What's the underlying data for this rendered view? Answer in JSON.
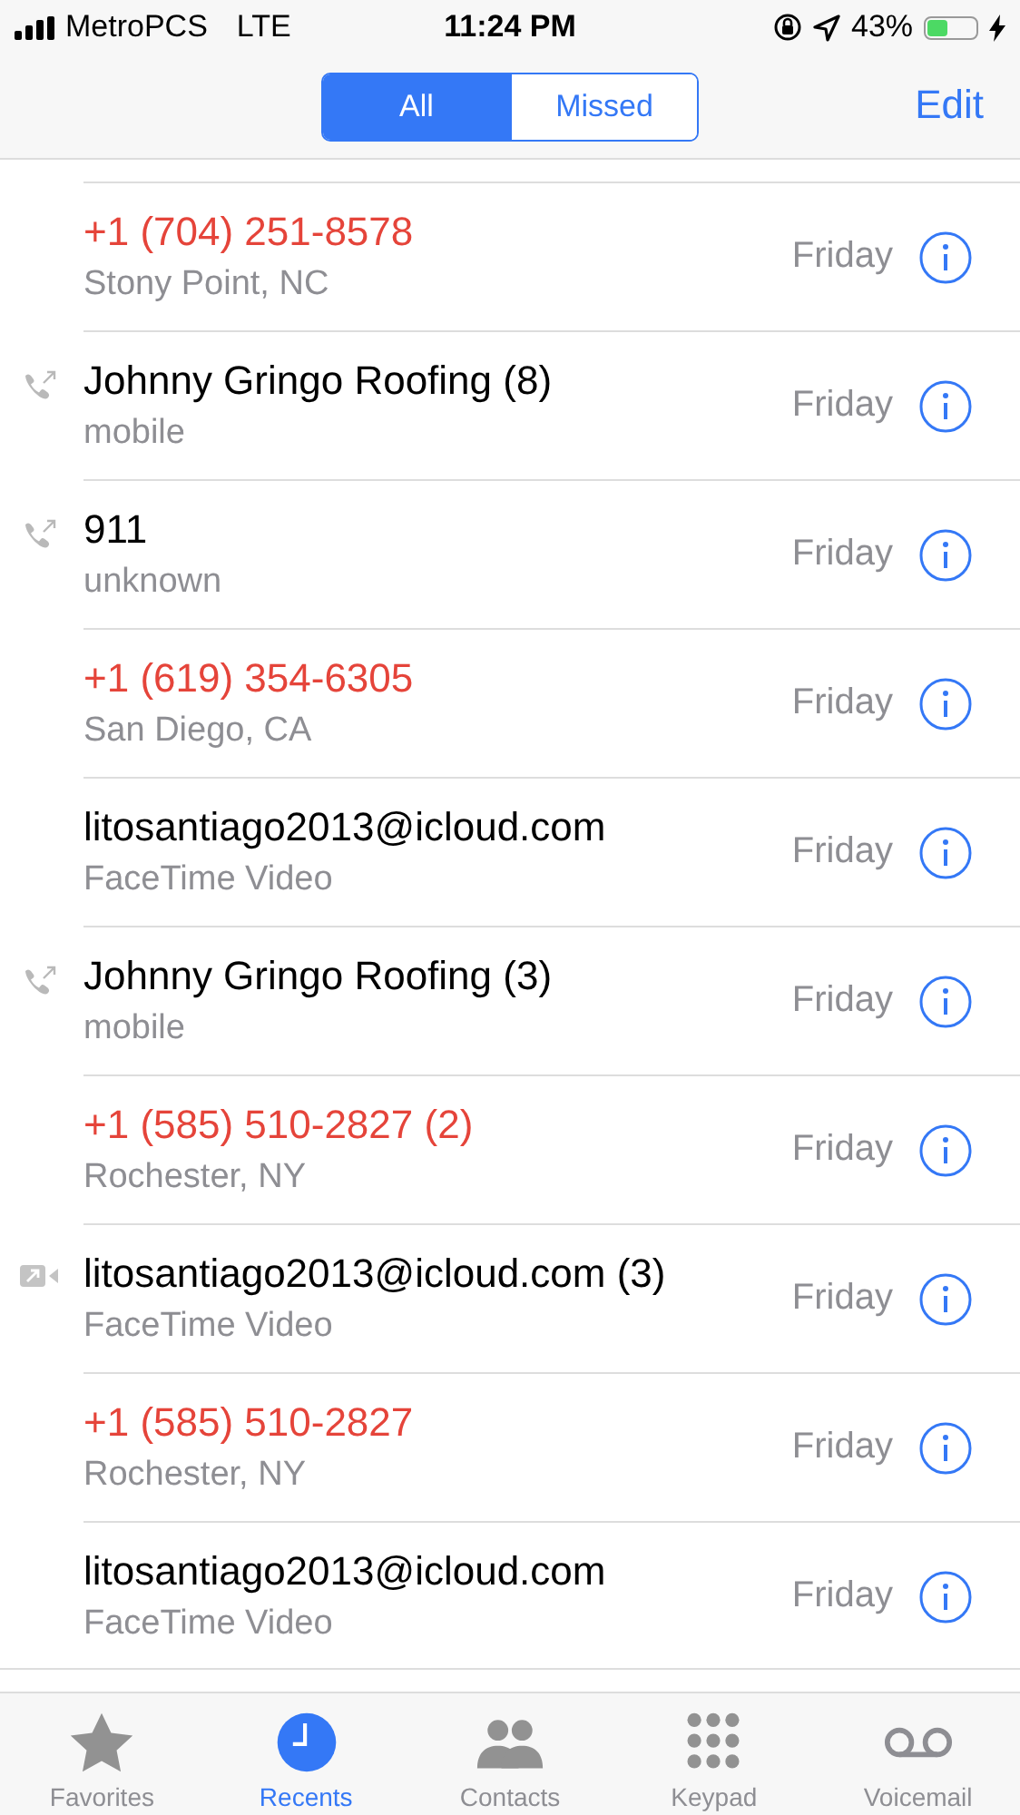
{
  "status_bar": {
    "carrier": "MetroPCS",
    "network": "LTE",
    "time": "11:24 PM",
    "battery": "43%"
  },
  "segments": [
    {
      "label": "All",
      "selected": true
    },
    {
      "label": "Missed",
      "selected": false
    }
  ],
  "edit_button": "Edit",
  "calls": [
    {
      "name": "+1 (704) 251-8578",
      "detail": "Stony Point, NC",
      "missed": true,
      "kind": "none",
      "date": "Friday"
    },
    {
      "name": "Johnny Gringo Roofing (8)",
      "detail": "mobile",
      "missed": false,
      "kind": "outgoing",
      "date": "Friday"
    },
    {
      "name": "911",
      "detail": "unknown",
      "missed": false,
      "kind": "outgoing",
      "date": "Friday"
    },
    {
      "name": "+1 (619) 354-6305",
      "detail": "San Diego, CA",
      "missed": true,
      "kind": "none",
      "date": "Friday"
    },
    {
      "name": "litosantiago2013@icloud.com",
      "detail": "FaceTime Video",
      "missed": false,
      "kind": "none",
      "date": "Friday"
    },
    {
      "name": "Johnny Gringo Roofing (3)",
      "detail": "mobile",
      "missed": false,
      "kind": "outgoing",
      "date": "Friday"
    },
    {
      "name": "+1 (585) 510-2827 (2)",
      "detail": "Rochester, NY",
      "missed": true,
      "kind": "none",
      "date": "Friday"
    },
    {
      "name": "litosantiago2013@icloud.com (3)",
      "detail": "FaceTime Video",
      "missed": false,
      "kind": "video",
      "date": "Friday"
    },
    {
      "name": "+1 (585) 510-2827",
      "detail": "Rochester, NY",
      "missed": true,
      "kind": "none",
      "date": "Friday"
    },
    {
      "name": "litosantiago2013@icloud.com",
      "detail": "FaceTime Video",
      "missed": false,
      "kind": "none",
      "date": "Friday"
    }
  ],
  "tab_bar": [
    {
      "label": "Favorites",
      "kind": "star",
      "selected": false
    },
    {
      "label": "Recents",
      "kind": "clock",
      "selected": true
    },
    {
      "label": "Contacts",
      "kind": "people",
      "selected": false
    },
    {
      "label": "Keypad",
      "kind": "keypad",
      "selected": false
    },
    {
      "label": "Voicemail",
      "kind": "voicemail",
      "selected": false
    }
  ]
}
